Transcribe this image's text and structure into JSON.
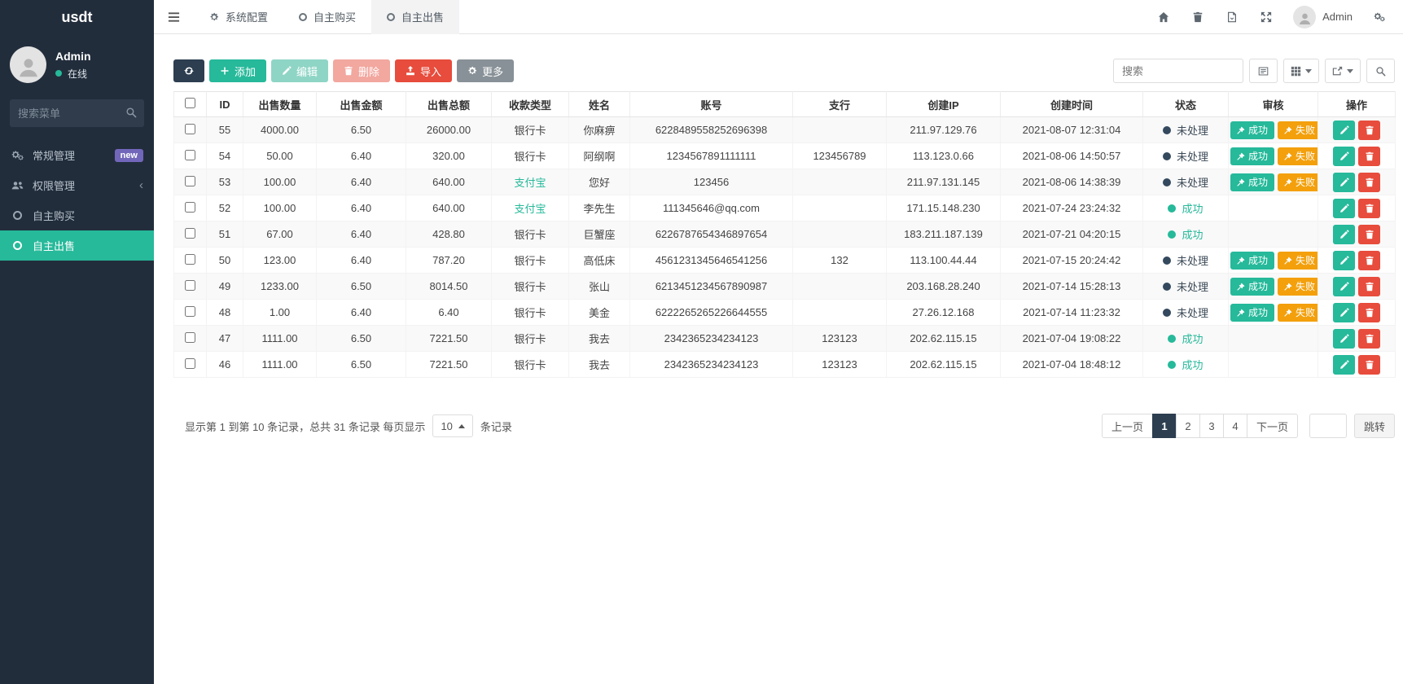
{
  "sidebar": {
    "brand": "usdt",
    "user": {
      "name": "Admin",
      "status_label": "在线"
    },
    "search_placeholder": "搜索菜单",
    "items": [
      {
        "label": "常规管理",
        "icon": "gears-icon",
        "badge": "new"
      },
      {
        "label": "权限管理",
        "icon": "users-icon",
        "chevron": true
      },
      {
        "label": "自主购买",
        "icon": "circle-icon"
      },
      {
        "label": "自主出售",
        "icon": "circle-icon",
        "active": true
      }
    ]
  },
  "topbar": {
    "tabs": [
      {
        "label": "系统配置",
        "icon": "gear-icon"
      },
      {
        "label": "自主购买",
        "icon": "circle-icon"
      },
      {
        "label": "自主出售",
        "icon": "circle-icon",
        "active": true
      }
    ],
    "user_label": "Admin"
  },
  "toolbar": {
    "add_label": "添加",
    "edit_label": "编辑",
    "delete_label": "删除",
    "import_label": "导入",
    "more_label": "更多",
    "search_placeholder": "搜索"
  },
  "table": {
    "columns": [
      "ID",
      "出售数量",
      "出售金额",
      "出售总额",
      "收款类型",
      "姓名",
      "账号",
      "支行",
      "创建IP",
      "创建时间",
      "状态",
      "审核",
      "操作"
    ],
    "rows": [
      {
        "id": "55",
        "qty": "4000.00",
        "price": "6.50",
        "total": "26000.00",
        "type": "银行卡",
        "name": "你麻痹",
        "account": "6228489558252696398",
        "branch": "",
        "ip": "211.97.129.76",
        "time": "2021-08-07 12:31:04",
        "status": "pending"
      },
      {
        "id": "54",
        "qty": "50.00",
        "price": "6.40",
        "total": "320.00",
        "type": "银行卡",
        "name": "阿纲啊",
        "account": "1234567891111111",
        "branch": "123456789",
        "ip": "113.123.0.66",
        "time": "2021-08-06 14:50:57",
        "status": "pending"
      },
      {
        "id": "53",
        "qty": "100.00",
        "price": "6.40",
        "total": "640.00",
        "type": "支付宝",
        "name": "您好",
        "account": "123456",
        "branch": "",
        "ip": "211.97.131.145",
        "time": "2021-08-06 14:38:39",
        "status": "pending"
      },
      {
        "id": "52",
        "qty": "100.00",
        "price": "6.40",
        "total": "640.00",
        "type": "支付宝",
        "name": "李先生",
        "account": "111345646@qq.com",
        "branch": "",
        "ip": "171.15.148.230",
        "time": "2021-07-24 23:24:32",
        "status": "success"
      },
      {
        "id": "51",
        "qty": "67.00",
        "price": "6.40",
        "total": "428.80",
        "type": "银行卡",
        "name": "巨蟹座",
        "account": "6226787654346897654",
        "branch": "",
        "ip": "183.211.187.139",
        "time": "2021-07-21 04:20:15",
        "status": "success"
      },
      {
        "id": "50",
        "qty": "123.00",
        "price": "6.40",
        "total": "787.20",
        "type": "银行卡",
        "name": "高低床",
        "account": "4561231345646541256",
        "branch": "132",
        "ip": "113.100.44.44",
        "time": "2021-07-15 20:24:42",
        "status": "pending"
      },
      {
        "id": "49",
        "qty": "1233.00",
        "price": "6.50",
        "total": "8014.50",
        "type": "银行卡",
        "name": "张山",
        "account": "6213451234567890987",
        "branch": "",
        "ip": "203.168.28.240",
        "time": "2021-07-14 15:28:13",
        "status": "pending"
      },
      {
        "id": "48",
        "qty": "1.00",
        "price": "6.40",
        "total": "6.40",
        "type": "银行卡",
        "name": "美金",
        "account": "6222265265226644555",
        "branch": "",
        "ip": "27.26.12.168",
        "time": "2021-07-14 11:23:32",
        "status": "pending"
      },
      {
        "id": "47",
        "qty": "1111.00",
        "price": "6.50",
        "total": "7221.50",
        "type": "银行卡",
        "name": "我去",
        "account": "2342365234234123",
        "branch": "123123",
        "ip": "202.62.115.15",
        "time": "2021-07-04 19:08:22",
        "status": "success"
      },
      {
        "id": "46",
        "qty": "1111.00",
        "price": "6.50",
        "total": "7221.50",
        "type": "银行卡",
        "name": "我去",
        "account": "2342365234234123",
        "branch": "123123",
        "ip": "202.62.115.15",
        "time": "2021-07-04 18:48:12",
        "status": "success"
      }
    ]
  },
  "labels": {
    "status_pending": "未处理",
    "status_success": "成功",
    "audit_success": "成功",
    "audit_fail": "失败",
    "type_alipay": "支付宝"
  },
  "footer": {
    "summary_prefix": "显示第 1 到第 10 条记录，总共 31 条记录 每页显示",
    "page_size": "10",
    "summary_suffix": "条记录",
    "prev_label": "上一页",
    "pages": [
      "1",
      "2",
      "3",
      "4"
    ],
    "active_page": "1",
    "next_label": "下一页",
    "jump_label": "跳转"
  },
  "colors": {
    "teal": "#26b99a",
    "navy": "#2c3e50",
    "red": "#e74c3c",
    "orange": "#f3a00c",
    "sidebar_bg": "#222d3c",
    "badge_purple": "#7266ba"
  }
}
